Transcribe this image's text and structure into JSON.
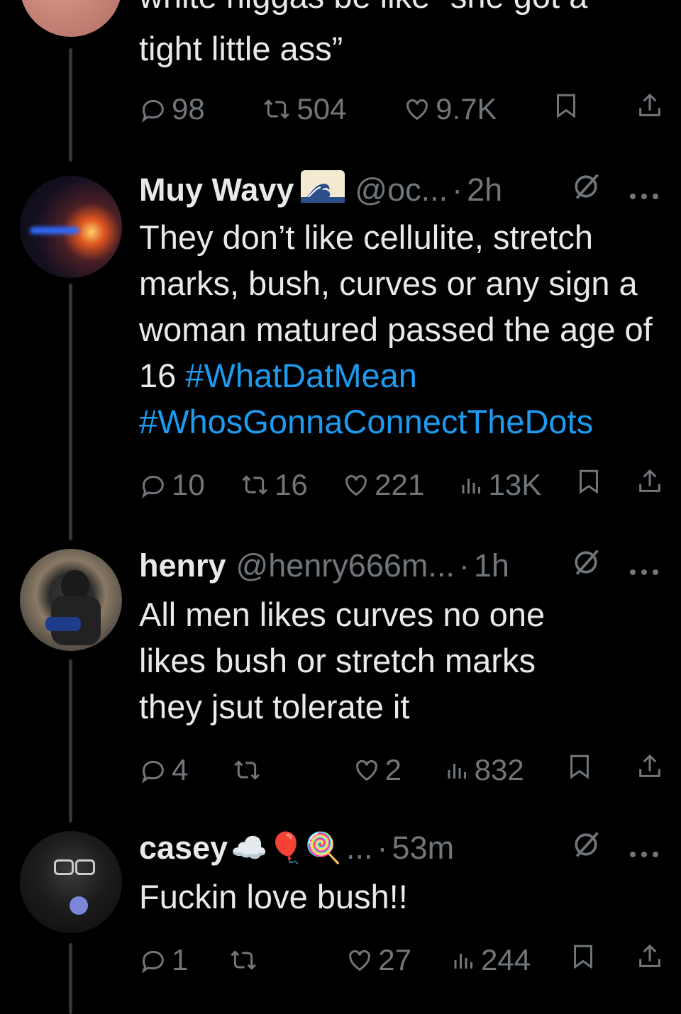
{
  "tweets": [
    {
      "partial_text_line": "white niggas be like “she got a",
      "text": "tight little ass”",
      "replies": "98",
      "retweets": "504",
      "likes": "9.7K"
    },
    {
      "name": "Muy Wavy",
      "handle": "@oc...",
      "dot": "·",
      "time": "2h",
      "text": "They don’t like cellulite, stretch marks, bush, curves or any sign a woman matured passed the age of 16 ",
      "hashtag1": "#WhatDatMean",
      "hashtag2": "#WhosGonnaConnectTheDots",
      "replies": "10",
      "retweets": "16",
      "likes": "221",
      "views": "13K"
    },
    {
      "name": "henry",
      "handle": "@henry666m...",
      "dot": "·",
      "time": "1h",
      "text": "All men likes curves no one likes bush or stretch marks they jsut tolerate it",
      "replies": "4",
      "likes": "2",
      "views": "832"
    },
    {
      "name": "casey",
      "emojis": "☁️🎈🍭",
      "handle": "...",
      "dot": "·",
      "time": "53m",
      "text": "Fuckin love bush!!",
      "replies": "1",
      "likes": "27",
      "views": "244"
    }
  ],
  "colors": {
    "background": "#000000",
    "text": "#e7e9ea",
    "muted": "#71767b",
    "link": "#1d9bf0",
    "thread": "#333639"
  },
  "icons": [
    "reply-icon",
    "retweet-icon",
    "like-icon",
    "views-icon",
    "bookmark-icon",
    "share-icon",
    "grok-icon",
    "more-icon",
    "wave-emoji-icon"
  ]
}
